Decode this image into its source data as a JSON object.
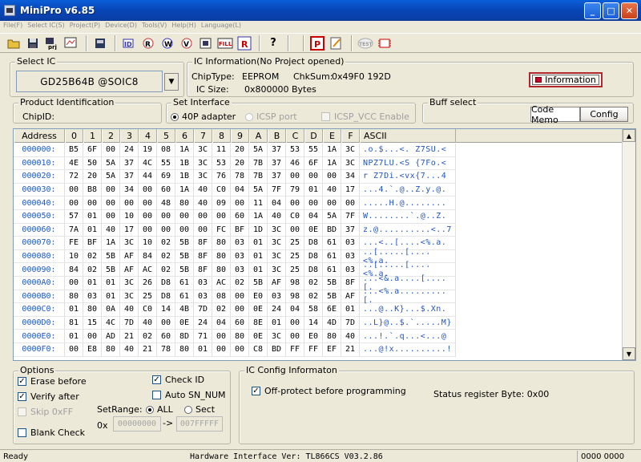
{
  "window": {
    "title": "MiniPro v6.85",
    "min": "_",
    "max": "□",
    "close": "✕"
  },
  "menu": [
    "File(F)",
    "Select IC(S)",
    "Project(P)",
    "Device(D)",
    "Tools(V)",
    "Help(H)",
    "Language(L)"
  ],
  "select_ic": {
    "legend": "Select IC",
    "chip": "GD25B64B @SOIC8",
    "dropdown_icon": "▼"
  },
  "ic_info": {
    "legend": "IC Information(No Project opened)",
    "chip_type_label": "ChipType:",
    "chip_type": "EEPROM",
    "chksum_label": "ChkSum:",
    "chksum": "0x49F0 192D",
    "ic_size_label": "IC Size:",
    "ic_size": "0x800000 Bytes",
    "info_button": "Information"
  },
  "product_id": {
    "legend": "Product Identification",
    "chip_id_label": "ChipID:"
  },
  "interface": {
    "legend": "Set Interface",
    "opt1": "40P adapter",
    "opt2": "ICSP port",
    "opt3": "ICSP_VCC Enable"
  },
  "buff": {
    "legend": "Buff select",
    "code_memo": "Code Memo",
    "config": "Config"
  },
  "hex": {
    "headers": [
      "Address",
      "0",
      "1",
      "2",
      "3",
      "4",
      "5",
      "6",
      "7",
      "8",
      "9",
      "A",
      "B",
      "C",
      "D",
      "E",
      "F",
      "ASCII"
    ],
    "rows": [
      [
        "000000:",
        "B5",
        "6F",
        "00",
        "24",
        "19",
        "08",
        "1A",
        "3C",
        "11",
        "20",
        "5A",
        "37",
        "53",
        "55",
        "1A",
        "3C",
        ".o.$...<. Z7SU.<"
      ],
      [
        "000010:",
        "4E",
        "50",
        "5A",
        "37",
        "4C",
        "55",
        "1B",
        "3C",
        "53",
        "20",
        "7B",
        "37",
        "46",
        "6F",
        "1A",
        "3C",
        "NPZ7LU.<S {7Fo.<"
      ],
      [
        "000020:",
        "72",
        "20",
        "5A",
        "37",
        "44",
        "69",
        "1B",
        "3C",
        "76",
        "78",
        "7B",
        "37",
        "00",
        "00",
        "00",
        "34",
        "r Z7Di.<vx{7...4"
      ],
      [
        "000030:",
        "00",
        "B8",
        "00",
        "34",
        "00",
        "60",
        "1A",
        "40",
        "C0",
        "04",
        "5A",
        "7F",
        "79",
        "01",
        "40",
        "17",
        "...4.`.@..Z.y.@."
      ],
      [
        "000040:",
        "00",
        "00",
        "00",
        "00",
        "00",
        "48",
        "80",
        "40",
        "09",
        "00",
        "11",
        "04",
        "00",
        "00",
        "00",
        "00",
        ".....H.@........"
      ],
      [
        "000050:",
        "57",
        "01",
        "00",
        "10",
        "00",
        "00",
        "00",
        "00",
        "00",
        "60",
        "1A",
        "40",
        "C0",
        "04",
        "5A",
        "7F",
        "W........`.@..Z."
      ],
      [
        "000060:",
        "7A",
        "01",
        "40",
        "17",
        "00",
        "00",
        "00",
        "00",
        "FC",
        "BF",
        "1D",
        "3C",
        "00",
        "0E",
        "BD",
        "37",
        "z.@..........<..7"
      ],
      [
        "000070:",
        "FE",
        "BF",
        "1A",
        "3C",
        "10",
        "02",
        "5B",
        "8F",
        "80",
        "03",
        "01",
        "3C",
        "25",
        "D8",
        "61",
        "03",
        "...<..[....<%.a."
      ],
      [
        "000080:",
        "10",
        "02",
        "5B",
        "AF",
        "84",
        "02",
        "5B",
        "8F",
        "80",
        "03",
        "01",
        "3C",
        "25",
        "D8",
        "61",
        "03",
        "..[.....[....<%.a."
      ],
      [
        "000090:",
        "84",
        "02",
        "5B",
        "AF",
        "AC",
        "02",
        "5B",
        "8F",
        "80",
        "03",
        "01",
        "3C",
        "25",
        "D8",
        "61",
        "03",
        "..[.....[....<%.a."
      ],
      [
        "0000A0:",
        "00",
        "01",
        "01",
        "3C",
        "26",
        "D8",
        "61",
        "03",
        "AC",
        "02",
        "5B",
        "AF",
        "98",
        "02",
        "5B",
        "8F",
        "...<&.a....[....[."
      ],
      [
        "0000B0:",
        "80",
        "03",
        "01",
        "3C",
        "25",
        "D8",
        "61",
        "03",
        "08",
        "00",
        "E0",
        "03",
        "98",
        "02",
        "5B",
        "AF",
        "...<%.a.........[."
      ],
      [
        "0000C0:",
        "01",
        "80",
        "0A",
        "40",
        "C0",
        "14",
        "4B",
        "7D",
        "02",
        "00",
        "0E",
        "24",
        "04",
        "58",
        "6E",
        "01",
        "...@..K}...$.Xn."
      ],
      [
        "0000D0:",
        "81",
        "15",
        "4C",
        "7D",
        "40",
        "00",
        "0E",
        "24",
        "04",
        "60",
        "8E",
        "01",
        "00",
        "14",
        "4D",
        "7D",
        "..L}@..$.`.....M}"
      ],
      [
        "0000E0:",
        "01",
        "00",
        "AD",
        "21",
        "02",
        "60",
        "8D",
        "71",
        "00",
        "80",
        "0E",
        "3C",
        "00",
        "E0",
        "80",
        "40",
        "...!.`.q...<...@"
      ],
      [
        "0000F0:",
        "00",
        "E8",
        "80",
        "40",
        "21",
        "78",
        "80",
        "01",
        "00",
        "00",
        "C8",
        "BD",
        "FF",
        "FF",
        "EF",
        "21",
        "...@!x..........!"
      ]
    ]
  },
  "options": {
    "legend": "Options",
    "erase": "Erase before",
    "verify": "Verify after",
    "skip": "Skip 0xFF",
    "blank": "Blank Check",
    "check_id": "Check ID",
    "auto_sn": "Auto SN_NUM",
    "setrange": "SetRange:",
    "all": "ALL",
    "sect": "Sect",
    "hex_prefix": "0x",
    "from": "00000000",
    "arrow": "->",
    "to": "007FFFFF",
    "check_mark": "✓"
  },
  "ic_config": {
    "legend": "IC Config Informaton",
    "off_protect": "Off-protect before programming",
    "status_reg": "Status register Byte: 0x00"
  },
  "status": {
    "ready": "Ready",
    "hw": "Hardware Interface Ver: TL866CS V03.2.86",
    "right": "0000 0000"
  },
  "scroll": {
    "up": "▲",
    "down": "▼"
  }
}
